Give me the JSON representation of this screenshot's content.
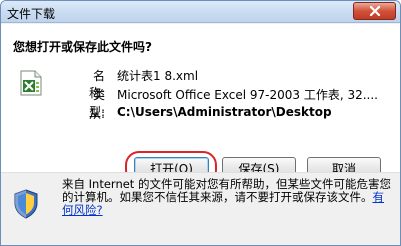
{
  "window": {
    "title": "文件下载"
  },
  "dialog": {
    "question": "您想打开或保存此文件吗?",
    "file_icon": "excel-file-icon",
    "fields": {
      "name_label": "名称:",
      "name_value": "统计表1 8.xml",
      "type_label": "类型:",
      "type_value": "Microsoft Office Excel 97-2003 工作表, 32....",
      "from_label": "从:",
      "from_value": "C:\\Users\\Administrator\\Desktop"
    },
    "buttons": {
      "open": "打开(O)",
      "save": "保存(S)",
      "cancel": "取消"
    }
  },
  "warning": {
    "icon": "shield-warning-icon",
    "text": "来自 Internet 的文件可能对您有所帮助，但某些文件可能危害您的计算机。如果您不信任其来源，请不要打开或保存该文件。",
    "link": "有何风险?"
  },
  "colors": {
    "accent_ring": "#d8262a",
    "link": "#0033cc",
    "close_button": "#c13b22"
  }
}
